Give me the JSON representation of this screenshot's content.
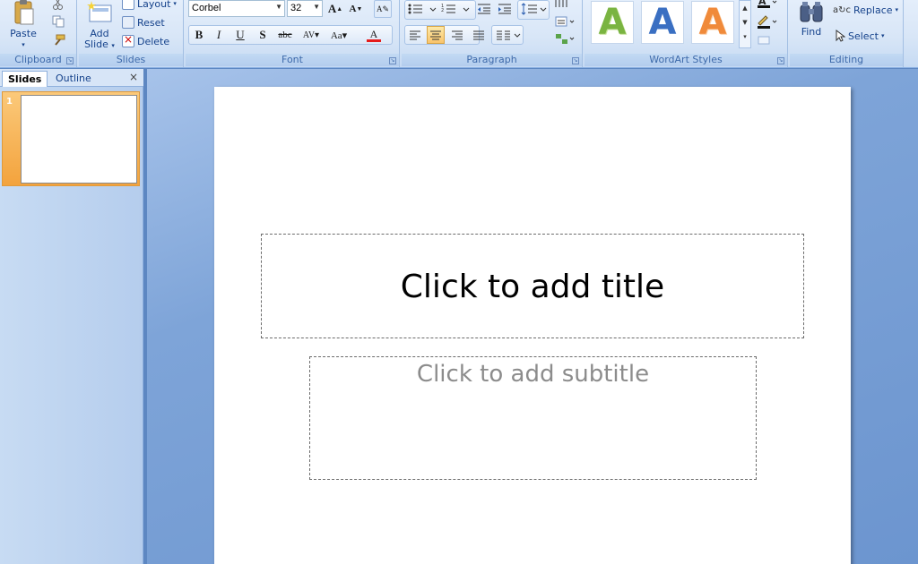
{
  "ribbon": {
    "clipboard": {
      "label": "Clipboard",
      "paste": "Paste"
    },
    "slides": {
      "label": "Slides",
      "add_slide_line1": "Add",
      "add_slide_line2": "Slide",
      "layout": "Layout",
      "reset": "Reset",
      "delete": "Delete"
    },
    "font": {
      "label": "Font",
      "font_name": "Corbel",
      "font_size": "32"
    },
    "paragraph": {
      "label": "Paragraph"
    },
    "wordart": {
      "label": "WordArt Styles",
      "letter": "A"
    },
    "editing": {
      "label": "Editing",
      "find": "Find",
      "replace": "Replace",
      "select": "Select"
    }
  },
  "left_pane": {
    "tabs": [
      "Slides",
      "Outline"
    ],
    "close": "×",
    "slide_number": "1"
  },
  "slide": {
    "title_placeholder": "Click to add title",
    "subtitle_placeholder": "Click to add subtitle"
  },
  "colors": {
    "font_color_bar": "#e51c1c",
    "wordart_green": "#7ab441",
    "wordart_blue": "#3a6fc2",
    "wordart_orange": "#f08a3a",
    "selected_thumb": "#f3a33d"
  }
}
